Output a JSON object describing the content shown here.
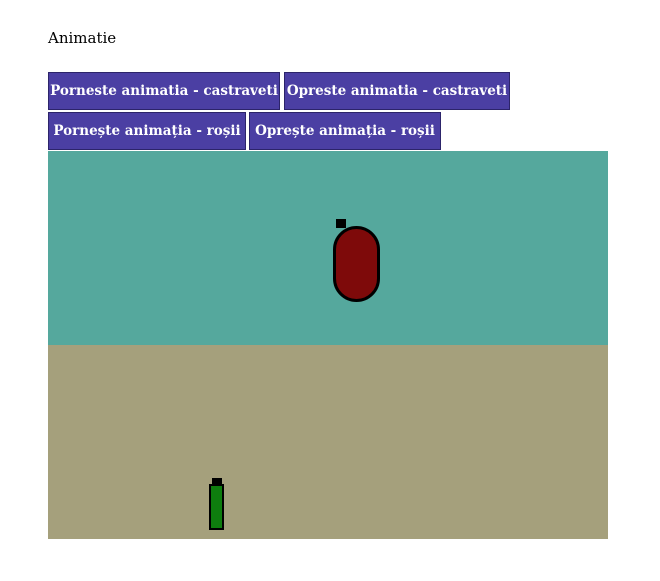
{
  "page": {
    "title": "Animatie"
  },
  "buttons": {
    "start_cucumbers": "Porneste animatia - castraveti",
    "stop_cucumbers": "Opreste animatia - castraveti",
    "start_tomatoes": "Pornește animația - roșii",
    "stop_tomatoes": "Oprește animația - roșii"
  },
  "colors": {
    "button_bg": "#4b3fa3",
    "sky": "#55a89d",
    "ground": "#a5a07c",
    "tomato": "#7e0a0a",
    "cucumber": "#0e7d0e"
  }
}
